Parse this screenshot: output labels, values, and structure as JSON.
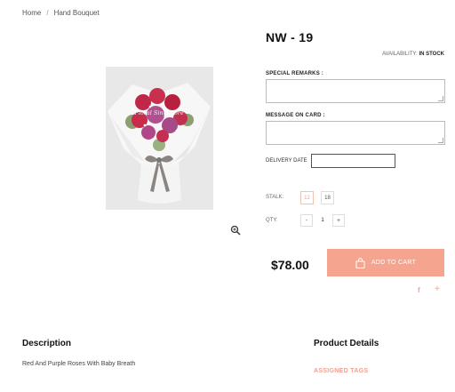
{
  "breadcrumb": {
    "home": "Home",
    "current": "Hand Bouquet"
  },
  "product": {
    "title": "NW - 19",
    "availability_label": "AVAILABILITY:",
    "availability_value": "IN STOCK",
    "price": "$78.00",
    "image_watermark": "Floral Singapore"
  },
  "form": {
    "special_remarks_label": "SPECIAL REMARKS :",
    "message_card_label": "MESSAGE ON CARD :",
    "delivery_date_label": "DELIVERY DATE",
    "delivery_date_value": ""
  },
  "stalk": {
    "label": "STALK:",
    "options": [
      "12",
      "18"
    ],
    "selected": "12"
  },
  "quantity": {
    "label": "QTY:",
    "minus": "-",
    "value": "1",
    "plus": "+"
  },
  "cart": {
    "add_label": "ADD TO CART"
  },
  "share": {
    "facebook": "f",
    "more": "+"
  },
  "description": {
    "heading": "Description",
    "text": "Red And Purple Roses With Baby Breath"
  },
  "details": {
    "heading": "Product Details",
    "tags_heading": "ASSIGNED TAGS"
  },
  "colors": {
    "accent": "#f5a58f",
    "accent_text": "#f0a090"
  }
}
